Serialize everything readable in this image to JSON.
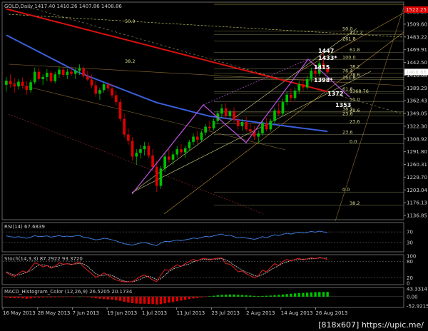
{
  "window": {
    "main_title": "GOLD,Daily  1417.40 1410.26 1407.86 1408.86",
    "rsi_title": "RSI(14) 67.6839",
    "stoch_title": "Stoch(14,3,3) 87.2922 93.3720",
    "macd_title": "MACD_Histogram_Color (12,26,9) 26.5205 20.1734",
    "watermark": "[818x607] https://upic.me/"
  },
  "colors": {
    "background": "#000000",
    "bull": "#00c000",
    "bear": "#e00000",
    "ma_blue": "#3a5fd8",
    "ma_red": "#d81010",
    "ma_green": "#30a050",
    "fib": "#d8d890",
    "purple": "#b04ad8",
    "rsi": "#3c78d8",
    "stoch_main": "#e02020",
    "stoch_signal": "#d8d8d8",
    "price_tag": "#e00000",
    "last_tag": "#ffffff"
  },
  "chart_data": [
    {
      "type": "candlestick",
      "title": "GOLD,Daily",
      "ylim": [
        1130,
        1528
      ],
      "y_ticks": [
        "1522.25",
        "1509.60",
        "1483.22",
        "1469.91",
        "1442.50",
        "1416.08",
        "1389.29",
        "1362.43",
        "1349.05",
        "1322.30",
        "1308.92",
        "1291.80",
        "1260.31",
        "1229.70",
        "1203.04",
        "1176.13",
        "1136.85"
      ],
      "price_tag": "1522.25",
      "last_price": "1408.86",
      "x_ticks": [
        "16 May 2013",
        "28 May 2013",
        "7 Jun 2013",
        "19 Jun 2013",
        "1 Jul 2013",
        "11 Jul 2013",
        "23 Jul 2013",
        "2 Aug 2013",
        "14 Aug 2013",
        "26 Aug 2013"
      ],
      "candles": [
        [
          1385,
          1400,
          1372,
          1393
        ],
        [
          1393,
          1405,
          1380,
          1386
        ],
        [
          1386,
          1398,
          1370,
          1382
        ],
        [
          1382,
          1396,
          1376,
          1391
        ],
        [
          1391,
          1399,
          1378,
          1383
        ],
        [
          1383,
          1392,
          1366,
          1375
        ],
        [
          1375,
          1395,
          1370,
          1390
        ],
        [
          1390,
          1418,
          1386,
          1410
        ],
        [
          1410,
          1418,
          1392,
          1396
        ],
        [
          1396,
          1405,
          1385,
          1400
        ],
        [
          1400,
          1415,
          1392,
          1408
        ],
        [
          1408,
          1412,
          1388,
          1392
        ],
        [
          1392,
          1410,
          1388,
          1405
        ],
        [
          1405,
          1420,
          1398,
          1414
        ],
        [
          1414,
          1418,
          1400,
          1404
        ],
        [
          1404,
          1416,
          1396,
          1410
        ],
        [
          1410,
          1420,
          1402,
          1406
        ],
        [
          1406,
          1418,
          1396,
          1412
        ],
        [
          1412,
          1424,
          1404,
          1416
        ],
        [
          1416,
          1420,
          1398,
          1402
        ],
        [
          1402,
          1412,
          1392,
          1395
        ],
        [
          1395,
          1405,
          1378,
          1384
        ],
        [
          1384,
          1392,
          1362,
          1368
        ],
        [
          1368,
          1380,
          1356,
          1375
        ],
        [
          1375,
          1390,
          1370,
          1386
        ],
        [
          1386,
          1392,
          1372,
          1378
        ],
        [
          1378,
          1386,
          1360,
          1365
        ],
        [
          1365,
          1374,
          1345,
          1352
        ],
        [
          1352,
          1358,
          1315,
          1320
        ],
        [
          1320,
          1330,
          1285,
          1290
        ],
        [
          1290,
          1302,
          1270,
          1278
        ],
        [
          1278,
          1285,
          1240,
          1248
        ],
        [
          1248,
          1262,
          1232,
          1255
        ],
        [
          1255,
          1270,
          1244,
          1262
        ],
        [
          1262,
          1276,
          1250,
          1268
        ],
        [
          1268,
          1275,
          1245,
          1250
        ],
        [
          1250,
          1262,
          1222,
          1228
        ],
        [
          1228,
          1240,
          1180,
          1192
        ],
        [
          1192,
          1230,
          1186,
          1225
        ],
        [
          1225,
          1255,
          1218,
          1248
        ],
        [
          1248,
          1262,
          1236,
          1242
        ],
        [
          1242,
          1258,
          1232,
          1252
        ],
        [
          1252,
          1268,
          1246,
          1262
        ],
        [
          1262,
          1272,
          1250,
          1256
        ],
        [
          1256,
          1268,
          1245,
          1264
        ],
        [
          1264,
          1280,
          1258,
          1276
        ],
        [
          1276,
          1292,
          1270,
          1286
        ],
        [
          1286,
          1296,
          1272,
          1280
        ],
        [
          1280,
          1298,
          1276,
          1294
        ],
        [
          1294,
          1310,
          1288,
          1305
        ],
        [
          1305,
          1316,
          1296,
          1302
        ],
        [
          1302,
          1320,
          1298,
          1316
        ],
        [
          1316,
          1336,
          1310,
          1330
        ],
        [
          1330,
          1348,
          1322,
          1340
        ],
        [
          1340,
          1350,
          1320,
          1326
        ],
        [
          1326,
          1338,
          1318,
          1334
        ],
        [
          1334,
          1342,
          1312,
          1318
        ],
        [
          1318,
          1326,
          1300,
          1306
        ],
        [
          1306,
          1320,
          1298,
          1314
        ],
        [
          1314,
          1324,
          1296,
          1300
        ],
        [
          1300,
          1312,
          1290,
          1296
        ],
        [
          1296,
          1306,
          1280,
          1286
        ],
        [
          1286,
          1298,
          1274,
          1292
        ],
        [
          1292,
          1318,
          1288,
          1312
        ],
        [
          1312,
          1322,
          1296,
          1300
        ],
        [
          1300,
          1320,
          1296,
          1316
        ],
        [
          1316,
          1340,
          1312,
          1336
        ],
        [
          1336,
          1350,
          1326,
          1330
        ],
        [
          1330,
          1358,
          1326,
          1352
        ],
        [
          1352,
          1372,
          1346,
          1366
        ],
        [
          1366,
          1378,
          1352,
          1360
        ],
        [
          1360,
          1380,
          1355,
          1374
        ],
        [
          1374,
          1392,
          1368,
          1386
        ],
        [
          1386,
          1398,
          1372,
          1380
        ],
        [
          1380,
          1402,
          1376,
          1396
        ],
        [
          1396,
          1418,
          1390,
          1412
        ],
        [
          1412,
          1424,
          1400,
          1406
        ],
        [
          1406,
          1430,
          1402,
          1426
        ],
        [
          1426,
          1446,
          1418,
          1417
        ],
        [
          1417,
          1420,
          1406,
          1409
        ]
      ],
      "moving_averages": [
        {
          "color": "blue",
          "values": [
            1480,
            1476,
            1472,
            1468,
            1464,
            1460,
            1456,
            1452,
            1448,
            1444,
            1440,
            1436,
            1432,
            1428,
            1424,
            1420,
            1416,
            1412,
            1408,
            1405,
            1402,
            1399,
            1396,
            1393,
            1390,
            1387,
            1384,
            1381,
            1378,
            1375,
            1372,
            1369,
            1366,
            1363,
            1360,
            1357,
            1354,
            1351,
            1349,
            1347,
            1345,
            1343,
            1341,
            1339,
            1337,
            1335,
            1333,
            1331,
            1329,
            1327,
            1325,
            1324,
            1323,
            1322,
            1321,
            1320,
            1319,
            1318,
            1317,
            1316,
            1315,
            1314,
            1313,
            1312,
            1311,
            1310,
            1309,
            1308,
            1307,
            1306,
            1305,
            1304,
            1303,
            1302,
            1301,
            1300,
            1299,
            1298,
            1297,
            1296
          ]
        },
        {
          "color": "red",
          "values": [
            1530,
            1528,
            1526,
            1524,
            1522,
            1520,
            1518,
            1516,
            1514,
            1512,
            1510,
            1508,
            1506,
            1504,
            1502,
            1500,
            1498,
            1496,
            1494,
            1492,
            1490,
            1488,
            1486,
            1484,
            1482,
            1480,
            1478,
            1476,
            1474,
            1472,
            1470,
            1468,
            1466,
            1464,
            1462,
            1460,
            1458,
            1456,
            1454,
            1452,
            1450,
            1448,
            1446,
            1444,
            1442,
            1440,
            1438,
            1436,
            1434,
            1432,
            1430,
            1428,
            1426,
            1424,
            1422,
            1420,
            1418,
            1416,
            1414,
            1412,
            1410,
            1408,
            1406,
            1404,
            1402,
            1400,
            1398,
            1396,
            1394,
            1392,
            1390,
            1388,
            1386,
            1384,
            1382,
            1380,
            1378,
            1376,
            1374,
            1372
          ]
        }
      ],
      "fib_levels": [
        {
          "label": "50.0",
          "value": 1487.95
        },
        {
          "label": "127.2",
          "value": 1481.09
        },
        {
          "label": "261.8",
          "value": 1469.0
        },
        {
          "label": "61.8",
          "value": 1447.32
        },
        {
          "label": "100.0",
          "value": 1433.5
        },
        {
          "label": "38.2",
          "value": 1415.3
        },
        {
          "label": "76.4",
          "value": 1407.3
        },
        {
          "label": "78.6",
          "value": 1399.6
        },
        {
          "label": "161.8",
          "value": 1395.05
        },
        {
          "label": "1368.76",
          "value": 1368.76
        },
        {
          "label": "61.8",
          "value": 1372.37
        },
        {
          "label": "50.0",
          "value": 1353.1
        },
        {
          "label": "38.2",
          "value": 1334.13
        },
        {
          "label": "78.6",
          "value": 1331.64
        },
        {
          "label": "23.6",
          "value": 1325.42
        },
        {
          "label": "23.6",
          "value": 1310.65
        },
        {
          "label": "23.6",
          "value": 1290.41
        },
        {
          "label": "0.0",
          "value": 1272.7
        },
        {
          "label": "0.0",
          "value": 1180.14
        },
        {
          "label": "38.2",
          "value": 1154.84
        }
      ],
      "annotations": [
        "50.0",
        "38.2",
        "1447",
        "1433*",
        "1415",
        "1398*",
        "1372",
        "1353"
      ]
    },
    {
      "type": "line",
      "title": "RSI(14) 67.6839",
      "ylim": [
        0,
        100
      ],
      "y_ticks": [
        "70",
        "30"
      ],
      "values": [
        55,
        52,
        50,
        52,
        49,
        46,
        50,
        56,
        52,
        53,
        55,
        50,
        53,
        56,
        52,
        54,
        52,
        55,
        56,
        50,
        48,
        44,
        40,
        42,
        46,
        44,
        40,
        36,
        30,
        25,
        23,
        20,
        24,
        28,
        30,
        26,
        22,
        18,
        28,
        34,
        33,
        36,
        39,
        37,
        40,
        43,
        47,
        45,
        49,
        53,
        51,
        55,
        59,
        62,
        55,
        58,
        52,
        47,
        50,
        47,
        45,
        42,
        46,
        52,
        48,
        54,
        59,
        56,
        61,
        65,
        62,
        66,
        69,
        66,
        68,
        72,
        69,
        73,
        70,
        68
      ]
    },
    {
      "type": "line",
      "title": "Stoch(14,3,3) 87.2922 93.3720",
      "ylim": [
        0,
        100
      ],
      "y_ticks": [
        "100",
        "80",
        "20",
        "0"
      ],
      "series": [
        {
          "values": [
            40,
            30,
            25,
            35,
            45,
            40,
            55,
            75,
            70,
            60,
            65,
            55,
            62,
            75,
            70,
            72,
            68,
            74,
            78,
            60,
            48,
            35,
            22,
            28,
            38,
            30,
            20,
            12,
            8,
            5,
            5,
            6,
            15,
            25,
            30,
            22,
            12,
            6,
            30,
            50,
            48,
            58,
            68,
            62,
            72,
            80,
            88,
            82,
            90,
            92,
            85,
            90,
            92,
            93,
            72,
            70,
            58,
            42,
            45,
            35,
            28,
            20,
            28,
            48,
            42,
            58,
            72,
            66,
            80,
            88,
            82,
            88,
            92,
            86,
            90,
            94,
            90,
            95,
            92,
            87
          ]
        },
        {
          "values": [
            42,
            35,
            30,
            30,
            35,
            40,
            47,
            57,
            67,
            68,
            65,
            60,
            61,
            64,
            69,
            72,
            70,
            71,
            73,
            71,
            62,
            48,
            35,
            28,
            29,
            32,
            29,
            21,
            13,
            8,
            6,
            5,
            9,
            15,
            23,
            26,
            21,
            13,
            16,
            29,
            43,
            52,
            58,
            63,
            67,
            71,
            80,
            83,
            87,
            88,
            89,
            89,
            89,
            91,
            86,
            78,
            67,
            57,
            48,
            41,
            36,
            28,
            25,
            32,
            39,
            49,
            57,
            65,
            73,
            78,
            85,
            86,
            87,
            89,
            89,
            90,
            91,
            93,
            92,
            93
          ]
        }
      ]
    },
    {
      "type": "bar",
      "title": "MACD_Histogram_Color (12,26,9) 26.5205 20.1734",
      "ylim": [
        -52.9215,
        43.3314
      ],
      "y_ticks": [
        "43.3314",
        "0.00",
        "-52.9215"
      ],
      "values": [
        -6,
        -8,
        -9,
        -8,
        -10,
        -12,
        -10,
        -7,
        -6,
        -5,
        -4,
        -5,
        -4,
        -3,
        -3,
        -2,
        -2,
        -1,
        0,
        -1,
        -3,
        -6,
        -9,
        -12,
        -14,
        -16,
        -18,
        -20,
        -24,
        -29,
        -33,
        -37,
        -39,
        -40,
        -40,
        -41,
        -42,
        -44,
        -42,
        -38,
        -34,
        -30,
        -26,
        -22,
        -18,
        -14,
        -10,
        -7,
        -4,
        -1,
        2,
        5,
        8,
        10,
        11,
        12,
        12,
        10,
        9,
        8,
        6,
        4,
        3,
        4,
        5,
        6,
        8,
        10,
        12,
        14,
        16,
        18,
        20,
        21,
        22,
        24,
        25,
        26,
        26,
        26.5
      ]
    }
  ]
}
